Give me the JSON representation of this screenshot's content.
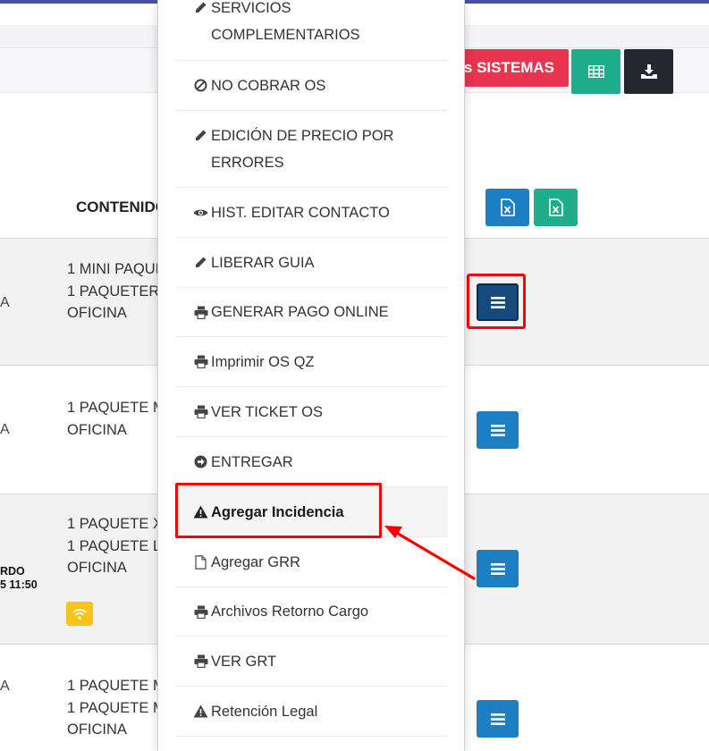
{
  "toolbar": {
    "sistemas_label": "as SISTEMAS",
    "table_icon": "table-icon",
    "download_icon": "download-icon"
  },
  "table": {
    "header_contenido": "CONTENIDO",
    "excel_icon": "file-excel-icon",
    "rows": [
      {
        "edge": "A",
        "text": "1 MINI PAQUE\n1 PAQUETER\nOFICINA"
      },
      {
        "edge": "A",
        "text": "1 PAQUETE M\nOFICINA"
      },
      {
        "edge_bold": "RDO\n5 11:50",
        "text": "1 PAQUETE X\n1 PAQUETE L\nOFICINA",
        "badge_icon": "wifi-icon"
      },
      {
        "edge": "A",
        "text": "1 PAQUETE M\n1 PAQUETE M\nOFICINA"
      }
    ],
    "row_menu_icon": "bars-icon"
  },
  "dropdown": {
    "items": [
      {
        "icon": "pencil-icon",
        "label": "SERVICIOS\nCOMPLEMENTARIOS"
      },
      {
        "icon": "ban-icon",
        "label": "NO COBRAR OS"
      },
      {
        "icon": "pencil-icon",
        "label": "EDICIÓN DE PRECIO POR\nERRORES"
      },
      {
        "icon": "eye-icon",
        "label": "HIST. EDITAR CONTACTO"
      },
      {
        "icon": "pencil-icon",
        "label": "LIBERAR GUIA"
      },
      {
        "icon": "print-icon",
        "label": "GENERAR PAGO ONLINE"
      },
      {
        "icon": "print-icon",
        "label": "Imprimir OS QZ"
      },
      {
        "icon": "print-icon",
        "label": "VER TICKET OS"
      },
      {
        "icon": "arrow-circle-right-icon",
        "label": "ENTREGAR"
      },
      {
        "icon": "warning-icon",
        "label": "Agregar Incidencia"
      },
      {
        "icon": "file-icon",
        "label": "Agregar GRR"
      },
      {
        "icon": "print-icon",
        "label": "Archivos Retorno Cargo"
      },
      {
        "icon": "print-icon",
        "label": "VER GRT"
      },
      {
        "icon": "warning-icon",
        "label": "Retención Legal"
      }
    ]
  },
  "annotation": {
    "highlight_color": "#ff0000"
  }
}
